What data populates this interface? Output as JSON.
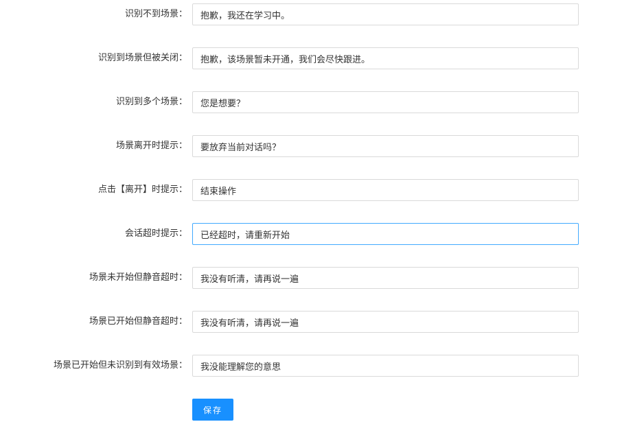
{
  "form": {
    "rows": [
      {
        "label": "识别不到场景：",
        "value": "抱歉，我还在学习中。"
      },
      {
        "label": "识别到场景但被关闭：",
        "value": "抱歉，该场景暂未开通，我们会尽快跟进。"
      },
      {
        "label": "识别到多个场景：",
        "value": "您是想要？"
      },
      {
        "label": "场景离开时提示：",
        "value": "要放弃当前对话吗？"
      },
      {
        "label": "点击【离开】时提示：",
        "value": "结束操作"
      },
      {
        "label": "会话超时提示：",
        "value": "已经超时，请重新开始"
      },
      {
        "label": "场景未开始但静音超时：",
        "value": "我没有听清，请再说一遍"
      },
      {
        "label": "场景已开始但静音超时：",
        "value": "我没有听清，请再说一遍"
      },
      {
        "label": "场景已开始但未识别到有效场景：",
        "value": "我没能理解您的意思"
      }
    ],
    "save_label": "保存",
    "focused_index": 5
  },
  "colors": {
    "primary": "#1890ff",
    "focus_border": "#40a9ff",
    "border": "#d9d9d9",
    "text": "#333333"
  }
}
